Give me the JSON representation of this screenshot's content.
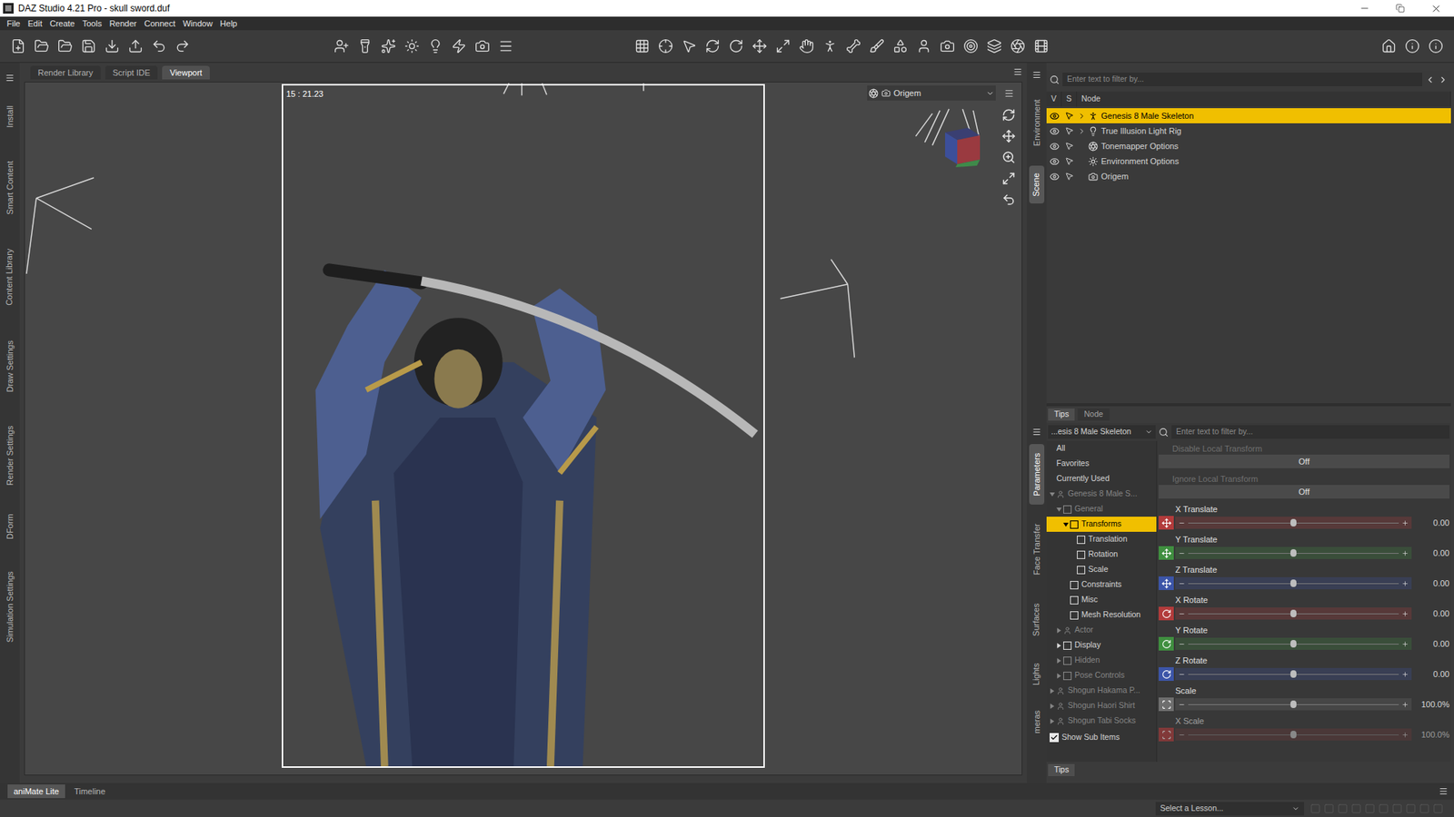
{
  "window": {
    "title": "DAZ Studio 4.21 Pro - skull sword.duf"
  },
  "menu": [
    "File",
    "Edit",
    "Create",
    "Tools",
    "Render",
    "Connect",
    "Window",
    "Help"
  ],
  "left_tabs": [
    {
      "label": "Install",
      "selected": false
    },
    {
      "label": "Smart Content",
      "selected": false
    },
    {
      "label": "Content Library",
      "selected": false
    },
    {
      "label": "Draw Settings",
      "selected": false
    },
    {
      "label": "Render Settings",
      "selected": false
    },
    {
      "label": "DForm",
      "selected": false
    },
    {
      "label": "Simulation Settings",
      "selected": false
    }
  ],
  "viewport_tabs": [
    {
      "label": "Render Library",
      "selected": false
    },
    {
      "label": "Script IDE",
      "selected": false
    },
    {
      "label": "Viewport",
      "selected": true
    }
  ],
  "viewport": {
    "time": "15 : 21.23",
    "camera": "Origem"
  },
  "right_tabs_top": [
    {
      "label": "Environment",
      "selected": false
    },
    {
      "label": "Scene",
      "selected": true
    }
  ],
  "right_tabs_bottom": [
    {
      "label": "Parameters",
      "selected": true
    },
    {
      "label": "Face Transfer",
      "selected": false
    },
    {
      "label": "Surfaces",
      "selected": false
    },
    {
      "label": "Lights",
      "selected": false
    },
    {
      "label": "meras",
      "selected": false
    }
  ],
  "scene": {
    "placeholder": "Enter text to filter by...",
    "columns": [
      "V",
      "S",
      "Node"
    ],
    "nodes": [
      {
        "label": "Genesis 8 Male Skeleton",
        "kind": "figure",
        "expandable": true,
        "selected": true
      },
      {
        "label": "True Illusion Light Rig",
        "kind": "light",
        "expandable": true,
        "selected": false
      },
      {
        "label": "Tonemapper Options",
        "kind": "tonemapper",
        "expandable": false,
        "selected": false
      },
      {
        "label": "Environment Options",
        "kind": "environment",
        "expandable": false,
        "selected": false
      },
      {
        "label": "Origem",
        "kind": "camera",
        "expandable": false,
        "selected": false
      }
    ]
  },
  "mid_tabs": [
    {
      "label": "Tips",
      "selected": true
    },
    {
      "label": "Node",
      "selected": false
    }
  ],
  "parameters": {
    "node": "...esis 8 Male Skeleton",
    "placeholder": "Enter text to filter by...",
    "tree": [
      {
        "label": "All",
        "depth": 0,
        "expander": "none",
        "kind": "filter",
        "selected": false,
        "dimmed": false
      },
      {
        "label": "Favorites",
        "depth": 0,
        "expander": "none",
        "kind": "filter",
        "selected": false,
        "dimmed": false
      },
      {
        "label": "Currently Used",
        "depth": 0,
        "expander": "none",
        "kind": "filter",
        "selected": false,
        "dimmed": false
      },
      {
        "label": "Genesis 8 Male S...",
        "depth": 0,
        "expander": "open",
        "kind": "figure",
        "selected": false,
        "dimmed": true
      },
      {
        "label": "General",
        "depth": 1,
        "expander": "open",
        "kind": "group",
        "selected": false,
        "dimmed": true
      },
      {
        "label": "Transforms",
        "depth": 2,
        "expander": "open",
        "kind": "group",
        "selected": true,
        "dimmed": false
      },
      {
        "label": "Translation",
        "depth": 3,
        "expander": "none",
        "kind": "group",
        "selected": false,
        "dimmed": false
      },
      {
        "label": "Rotation",
        "depth": 3,
        "expander": "none",
        "kind": "group",
        "selected": false,
        "dimmed": false
      },
      {
        "label": "Scale",
        "depth": 3,
        "expander": "none",
        "kind": "group",
        "selected": false,
        "dimmed": false
      },
      {
        "label": "Constraints",
        "depth": 2,
        "expander": "none",
        "kind": "group",
        "selected": false,
        "dimmed": false
      },
      {
        "label": "Misc",
        "depth": 2,
        "expander": "none",
        "kind": "group",
        "selected": false,
        "dimmed": false
      },
      {
        "label": "Mesh Resolution",
        "depth": 2,
        "expander": "none",
        "kind": "group",
        "selected": false,
        "dimmed": false
      },
      {
        "label": "Actor",
        "depth": 1,
        "expander": "closed",
        "kind": "figure",
        "selected": false,
        "dimmed": true
      },
      {
        "label": "Display",
        "depth": 1,
        "expander": "closed",
        "kind": "group",
        "selected": false,
        "dimmed": false
      },
      {
        "label": "Hidden",
        "depth": 1,
        "expander": "closed",
        "kind": "group",
        "selected": false,
        "dimmed": true
      },
      {
        "label": "Pose Controls",
        "depth": 1,
        "expander": "closed",
        "kind": "group",
        "selected": false,
        "dimmed": true
      },
      {
        "label": "Shogun Hakama P...",
        "depth": 0,
        "expander": "closed",
        "kind": "figure",
        "selected": false,
        "dimmed": true
      },
      {
        "label": "Shogun Haori Shirt",
        "depth": 0,
        "expander": "closed",
        "kind": "figure",
        "selected": false,
        "dimmed": true
      },
      {
        "label": "Shogun Tabi Socks",
        "depth": 0,
        "expander": "closed",
        "kind": "figure",
        "selected": false,
        "dimmed": true
      }
    ],
    "show_sub_items": {
      "label": "Show Sub Items",
      "checked": true
    },
    "properties": [
      {
        "kind": "toggle",
        "label": "Disable Local Transform",
        "value": "Off",
        "dimmed": true
      },
      {
        "kind": "toggle",
        "label": "Ignore Local Transform",
        "value": "Off",
        "dimmed": true
      },
      {
        "kind": "translate",
        "label": "X Translate",
        "value": "0.00",
        "level": 0.5,
        "color": "#b23b3b",
        "dimmed": false
      },
      {
        "kind": "translate",
        "label": "Y Translate",
        "value": "0.00",
        "level": 0.5,
        "color": "#3f8f3f",
        "dimmed": false
      },
      {
        "kind": "translate",
        "label": "Z Translate",
        "value": "0.00",
        "level": 0.5,
        "color": "#3c55a8",
        "dimmed": false
      },
      {
        "kind": "rotate",
        "label": "X Rotate",
        "value": "0.00",
        "level": 0.5,
        "color": "#b23b3b",
        "dimmed": false
      },
      {
        "kind": "rotate",
        "label": "Y Rotate",
        "value": "0.00",
        "level": 0.5,
        "color": "#3f8f3f",
        "dimmed": false
      },
      {
        "kind": "rotate",
        "label": "Z Rotate",
        "value": "0.00",
        "level": 0.5,
        "color": "#3c55a8",
        "dimmed": false
      },
      {
        "kind": "scale",
        "label": "Scale",
        "value": "100.0%",
        "level": 0.5,
        "color": "#6e6e6e",
        "dimmed": false
      },
      {
        "kind": "scale",
        "label": "X Scale",
        "value": "100.0%",
        "level": 0.5,
        "color": "#b23b3b",
        "dimmed": true
      }
    ]
  },
  "bottom_panel_tab": {
    "label": "Tips",
    "selected": true
  },
  "bottom_tabs": [
    {
      "label": "aniMate Lite",
      "selected": true
    },
    {
      "label": "Timeline",
      "selected": false
    }
  ],
  "status": {
    "lesson": "Select a Lesson..."
  }
}
